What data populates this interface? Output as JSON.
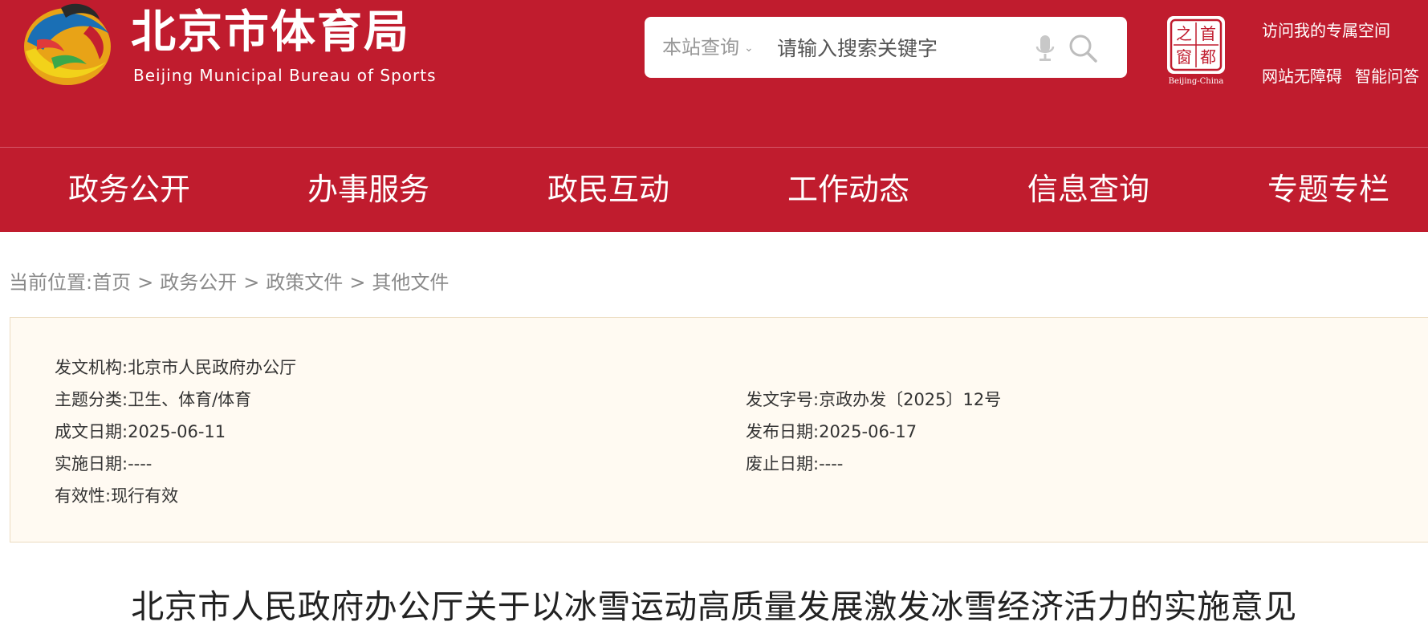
{
  "header": {
    "logo_cn": "北京市体育局",
    "logo_en": "Beijing Municipal Bureau of Sports",
    "search": {
      "scope_label": "本站查询",
      "placeholder": "请输入搜索关键字"
    },
    "badge": {
      "chars": [
        "之",
        "首",
        "窗",
        "都"
      ],
      "caption": "Beijing-China"
    },
    "links": {
      "personal_space": "访问我的专属空间",
      "accessibility": "网站无障碍",
      "smart_qa": "智能问答"
    },
    "colors": {
      "brand_red": "#c01c2e"
    }
  },
  "nav": {
    "items": [
      "政务公开",
      "办事服务",
      "政民互动",
      "工作动态",
      "信息查询",
      "专题专栏"
    ]
  },
  "breadcrumb": {
    "prefix": "当前位置:",
    "items": [
      "首页",
      "政务公开",
      "政策文件",
      "其他文件"
    ],
    "separator": ">"
  },
  "info": {
    "issuer": {
      "label": "发文机构:",
      "value": "北京市人民政府办公厅"
    },
    "topic": {
      "label": "主题分类:",
      "value": "卫生、体育/体育"
    },
    "doc_no": {
      "label": "发文字号:",
      "value": "京政办发〔2025〕12号"
    },
    "written_date": {
      "label": "成文日期:",
      "value": "2025-06-11"
    },
    "publish_date": {
      "label": "发布日期:",
      "value": "2025-06-17"
    },
    "effective_date": {
      "label": "实施日期:",
      "value": "----"
    },
    "repeal_date": {
      "label": "废止日期:",
      "value": "----"
    },
    "validity": {
      "label": "有效性:",
      "value": "现行有效"
    }
  },
  "document": {
    "title": "北京市人民政府办公厅关于以冰雪运动高质量发展激发冰雪经济活力的实施意见"
  }
}
